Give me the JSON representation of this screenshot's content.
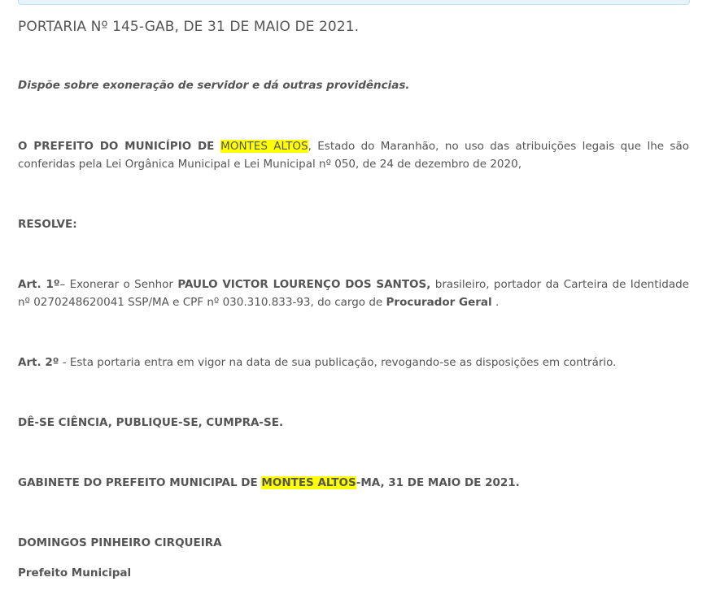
{
  "document": {
    "title": "PORTARIA Nº 145-GAB, DE 31 DE MAIO DE 2021.",
    "ementa": "Dispõe sobre exoneração de servidor e dá outras providências.",
    "preambulo": {
      "lead": "O PREFEITO DO MUNICÍPIO DE ",
      "municipio": "MONTES ALTOS",
      "rest": ", Estado do Maranhão, no uso das atribuições legais que lhe são conferidas pela Lei Orgânica Municipal e Lei Municipal nº 050, de 24 de dezembro de 2020,"
    },
    "resolve": "RESOLVE:",
    "art1": {
      "label": "Art. 1º",
      "text_a": "– Exonerar o Senhor ",
      "nome": "PAULO VICTOR LOURENÇO DOS SANTOS,",
      "text_b": " brasileiro, portador da Carteira de Identidade nº 0270248620041 SSP/MA e CPF nº 030.310.833-93, do cargo de ",
      "cargo": "Procurador Geral",
      "text_c": " ."
    },
    "art2": {
      "label": "Art. 2º",
      "text": " - Esta portaria entra em vigor na data de sua publicação, revogando-se as disposições em contrário."
    },
    "ciencia": "DÊ-SE CIÊNCIA, PUBLIQUE-SE, CUMPRA-SE.",
    "gabinete": {
      "lead": "GABINETE DO PREFEITO MUNICIPAL DE ",
      "municipio": "MONTES ALTOS",
      "rest": "-MA, 31 DE MAIO DE 2021."
    },
    "assinatura": {
      "nome": "DOMINGOS PINHEIRO CIRQUEIRA",
      "cargo": "Prefeito Municipal"
    }
  },
  "colors": {
    "text": "#555555",
    "highlight": "#ffff00",
    "top_bar": "#e6f3fa"
  }
}
